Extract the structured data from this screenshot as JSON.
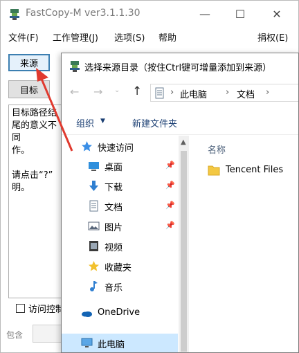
{
  "main_window": {
    "title": "FastCopy-M ver3.1.1.30",
    "controls": {
      "minimize": "—",
      "maximize": "☐",
      "close": "✕"
    },
    "menu": {
      "file": "文件(F)",
      "job": "工作管理(J)",
      "options": "选项(S)",
      "help": "帮助",
      "donate": "捐权(E)"
    },
    "source_button": "来源",
    "dest_button": "目标",
    "description": "目标路径结尾的意义不同\n作。\n\n请点击“?”\n明。",
    "acl_label": "访问控制",
    "include_label": "包含"
  },
  "dialog": {
    "title": "选择来源目录（按住Ctrl键可增量添加到来源）",
    "nav": {
      "back": "←",
      "forward": "→",
      "history": "⌄",
      "up": "↑"
    },
    "address": {
      "sep": "›",
      "crumb1": "此电脑",
      "crumb2": "文档"
    },
    "commands": {
      "organize": "组织",
      "organize_arrow": "▼",
      "new_folder": "新建文件夹"
    },
    "nav_items": [
      {
        "label": "快速访问",
        "icon": "star-icon",
        "pin": ""
      },
      {
        "label": "桌面",
        "icon": "desktop-icon",
        "pin": "📌"
      },
      {
        "label": "下载",
        "icon": "download-icon",
        "pin": "📌"
      },
      {
        "label": "文档",
        "icon": "document-icon",
        "pin": "📌"
      },
      {
        "label": "图片",
        "icon": "picture-icon",
        "pin": "📌"
      },
      {
        "label": "视频",
        "icon": "video-icon",
        "pin": ""
      },
      {
        "label": "收藏夹",
        "icon": "favorites-icon",
        "pin": ""
      },
      {
        "label": "音乐",
        "icon": "music-icon",
        "pin": ""
      },
      {
        "label": "OneDrive",
        "icon": "onedrive-icon",
        "pin": ""
      },
      {
        "label": "此电脑",
        "icon": "computer-icon",
        "pin": ""
      }
    ],
    "column_name": "名称",
    "files": [
      {
        "name": "Tencent Files",
        "icon": "folder-icon"
      }
    ]
  },
  "colors": {
    "accent": "#3c7fb1",
    "selection": "#cce8ff",
    "arrow": "#e03a2f",
    "folder": "#f3c843"
  }
}
